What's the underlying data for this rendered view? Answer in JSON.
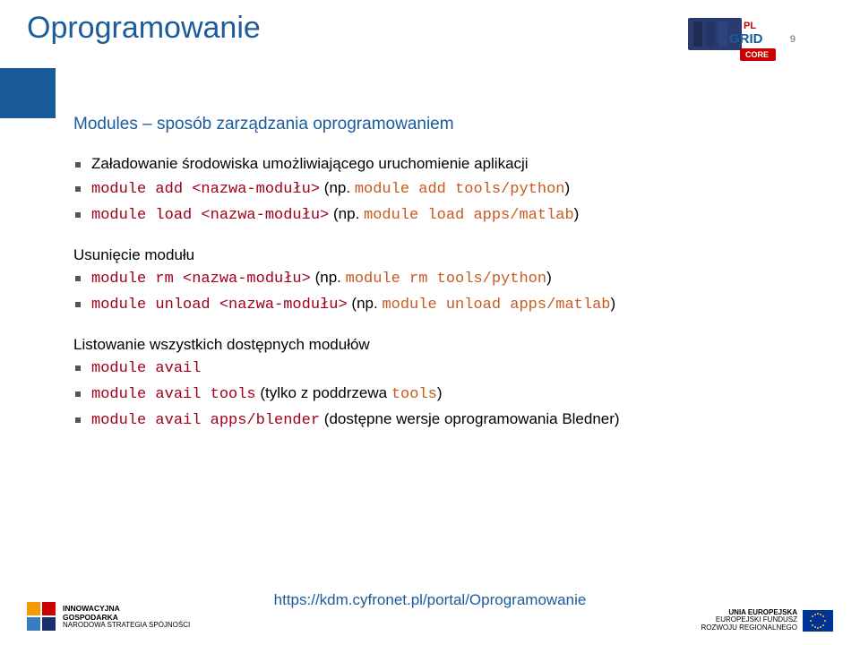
{
  "title": "Oprogramowanie",
  "page_number": "9",
  "subtitle": "Modules – sposób zarządzania oprogramowaniem",
  "sections": [
    {
      "label": "Załadowanie środowiska umożliwiającego uruchomienie aplikacji",
      "items": [
        {
          "code": "module add <nazwa-modułu>",
          "np": "np.",
          "eg": "module add tools/python"
        },
        {
          "code": "module load <nazwa-modułu>",
          "np": "np.",
          "eg": "module load apps/matlab"
        }
      ]
    },
    {
      "label": "Usunięcie modułu",
      "items": [
        {
          "code": "module rm <nazwa-modułu>",
          "np": "np.",
          "eg": "module rm tools/python"
        },
        {
          "code": "module unload <nazwa-modułu>",
          "np": "np.",
          "eg": "module unload apps/matlab"
        }
      ]
    },
    {
      "label": "Listowanie wszystkich dostępnych modułów",
      "items": [
        {
          "code": "module avail"
        },
        {
          "code": "module avail tools",
          "note": "(tylko z poddrzewa ",
          "warm": "tools",
          "note2": ")"
        },
        {
          "code": "module avail apps/blender",
          "note": "(dostępne wersje oprogramowania Bledner)"
        }
      ]
    }
  ],
  "footer_url": "https://kdm.cyfronet.pl/portal/Oprogramowanie",
  "logo_ig": {
    "l1": "INNOWACYJNA",
    "l2": "GOSPODARKA",
    "l3": "NARODOWA STRATEGIA SPÓJNOŚCI"
  },
  "logo_eu": {
    "l1": "UNIA EUROPEJSKA",
    "l2": "EUROPEJSKI FUNDUSZ",
    "l3": "ROZWOJU REGIONALNEGO"
  }
}
